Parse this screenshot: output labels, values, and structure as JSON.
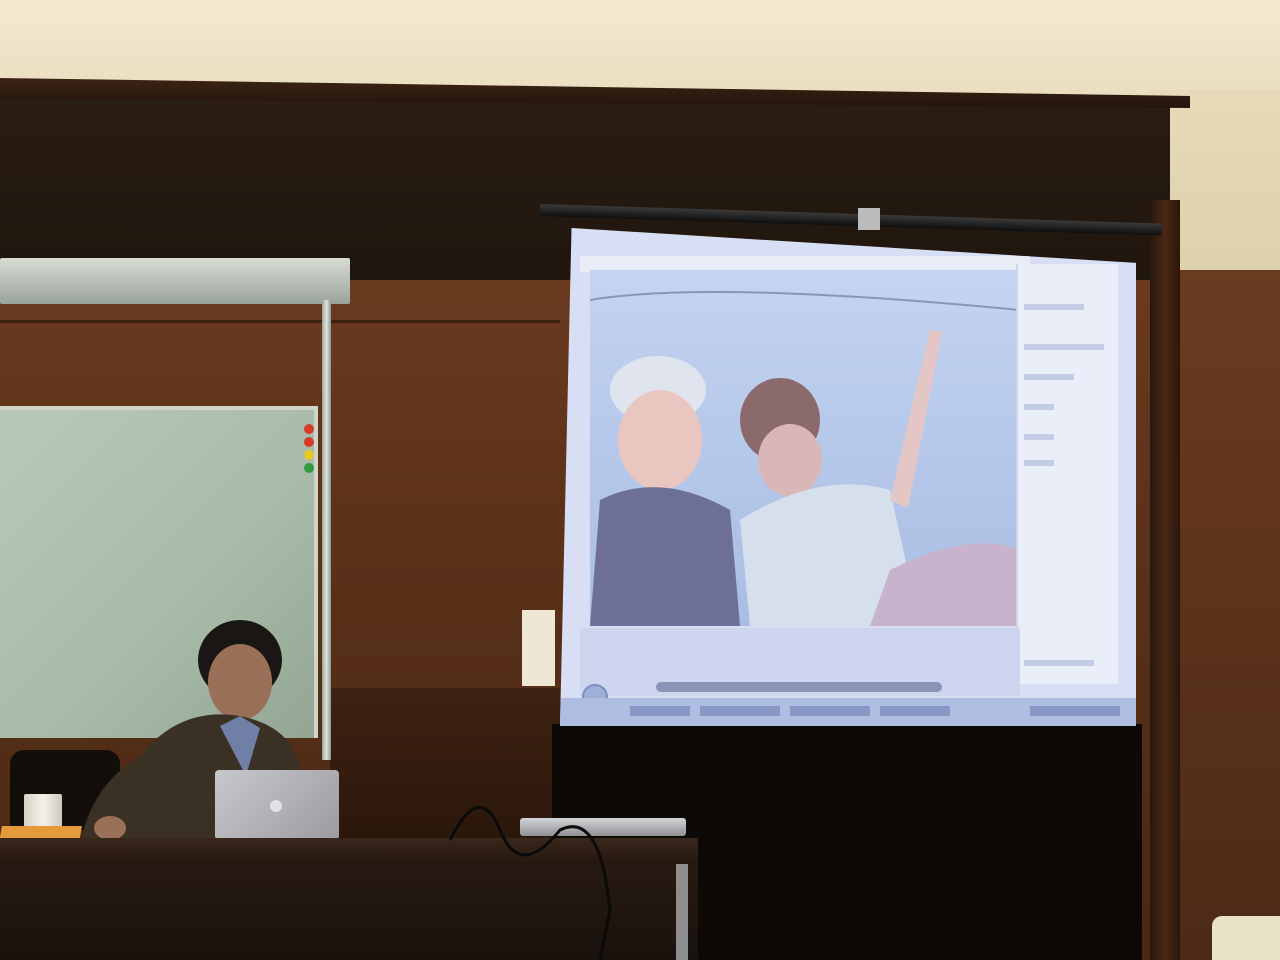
{
  "scene": {
    "type": "photograph",
    "setting": "lecture-room",
    "colors": {
      "wall": "#efe4c6",
      "paneling": "#5a3119",
      "screen": "#d8dff5",
      "whiteboard": "#a7b9a7",
      "desk": "#1a120d"
    }
  },
  "magnets": [
    "#d83a2a",
    "#d83a2a",
    "#e6c822",
    "#2f9b3e"
  ]
}
